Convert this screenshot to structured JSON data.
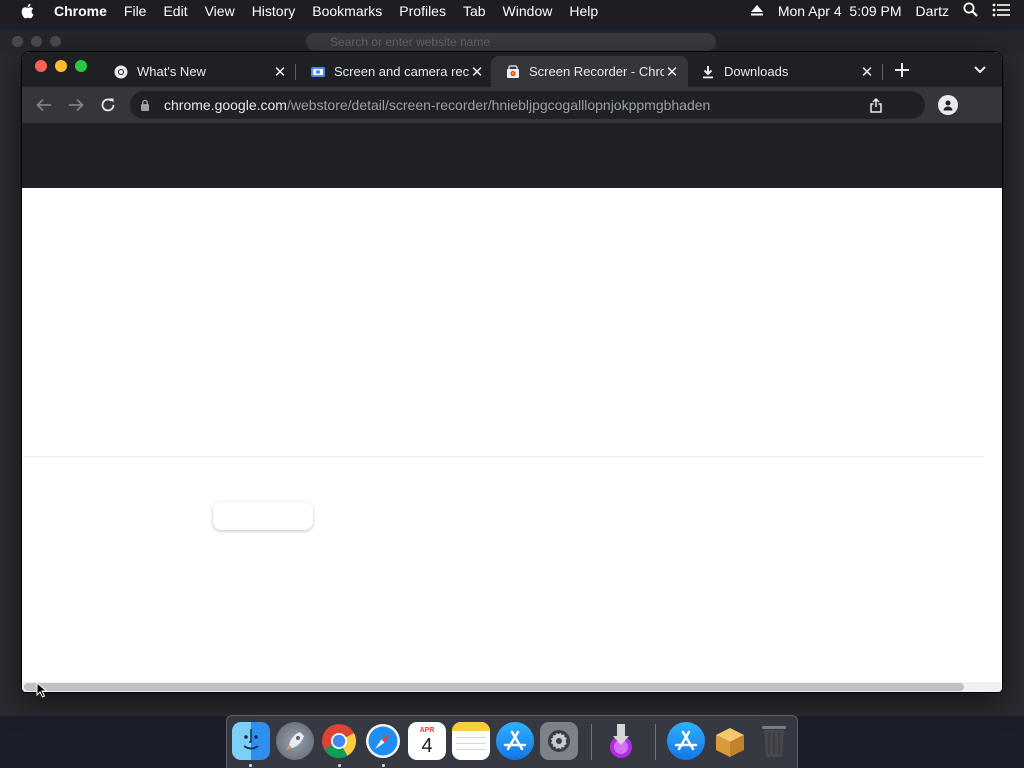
{
  "menubar": {
    "app_name": "Chrome",
    "items": [
      "File",
      "Edit",
      "View",
      "History",
      "Bookmarks",
      "Profiles",
      "Tab",
      "Window",
      "Help"
    ],
    "clock": "Mon Apr 4  5:09 PM",
    "user": "Dartz"
  },
  "background_window": {
    "address_placeholder": "Search or enter website name"
  },
  "tabs": [
    {
      "title": "What's New",
      "favicon": "chrome-icon",
      "active": false
    },
    {
      "title": "Screen and camera rec",
      "favicon": "screen-camera-icon",
      "active": false
    },
    {
      "title": "Screen Recorder - Chro",
      "favicon": "webstore-icon",
      "active": true
    },
    {
      "title": "Downloads",
      "favicon": "download-icon",
      "active": false
    }
  ],
  "toolbar": {
    "url_host": "chrome.google.com",
    "url_path": "/webstore/detail/screen-recorder/hniebljpgcogalllopnjokppmgbhaden"
  },
  "dock": {
    "apps": [
      "Finder",
      "Launchpad",
      "Google Chrome",
      "Safari",
      "Calendar",
      "Notes",
      "App Store",
      "System Preferences",
      "Downloads Stack",
      "App Store Folder",
      "Archive Utility",
      "Trash"
    ],
    "calendar": {
      "month": "APR",
      "day": "4"
    }
  },
  "colors": {
    "menubar_bg": "#1e1e22",
    "tabstrip_bg": "#1f2024",
    "active_tab_bg": "#35363a",
    "page_header_bg": "#202124",
    "close_red": "#fe5f57",
    "minimize_yellow": "#febc2e",
    "zoom_green": "#28c840"
  }
}
